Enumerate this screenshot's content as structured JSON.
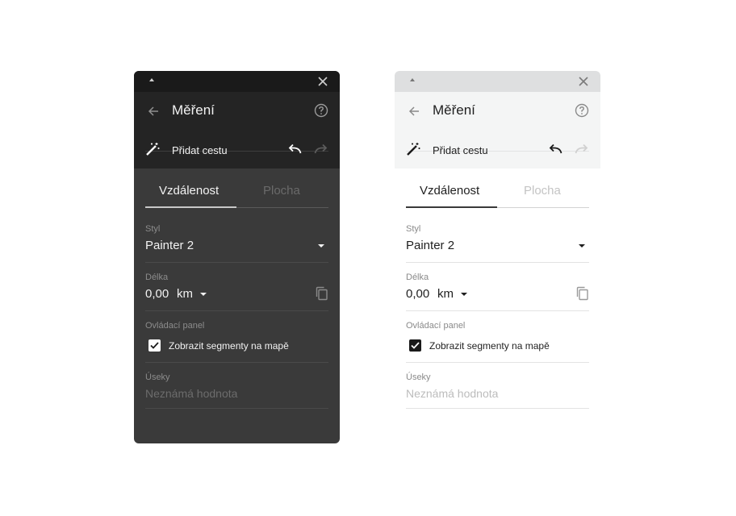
{
  "panels": [
    {
      "theme": "dark",
      "title": "Měření",
      "action_label": "Přidat cestu",
      "tabs": [
        "Vzdálenost",
        "Plocha"
      ],
      "style_caption": "Styl",
      "style_value": "Painter 2",
      "length_caption": "Délka",
      "length_value": "0,00",
      "length_unit": "km",
      "panel_caption": "Ovládací panel",
      "checkbox_label": "Zobrazit segmenty na mapě",
      "segments_caption": "Úseky",
      "segments_placeholder": "Neznámá hodnota"
    },
    {
      "theme": "light",
      "title": "Měření",
      "action_label": "Přidat cestu",
      "tabs": [
        "Vzdálenost",
        "Plocha"
      ],
      "style_caption": "Styl",
      "style_value": "Painter 2",
      "length_caption": "Délka",
      "length_value": "0,00",
      "length_unit": "km",
      "panel_caption": "Ovládací panel",
      "checkbox_label": "Zobrazit segmenty na mapě",
      "segments_caption": "Úseky",
      "segments_placeholder": "Neznámá hodnota"
    }
  ],
  "icons": [
    "collapse-icon",
    "close-icon",
    "back-arrow-icon",
    "help-icon",
    "magic-wand-icon",
    "undo-icon",
    "redo-icon",
    "dropdown-caret-icon",
    "copy-icon",
    "checkbox-check-icon"
  ],
  "colors": {
    "dark_bg": "#3a3a3a",
    "dark_header": "#242424",
    "dark_titlebar": "#1a1a1a",
    "light_bg": "#ffffff",
    "light_header": "#f4f5f5",
    "light_titlebar": "#dedfe0"
  }
}
